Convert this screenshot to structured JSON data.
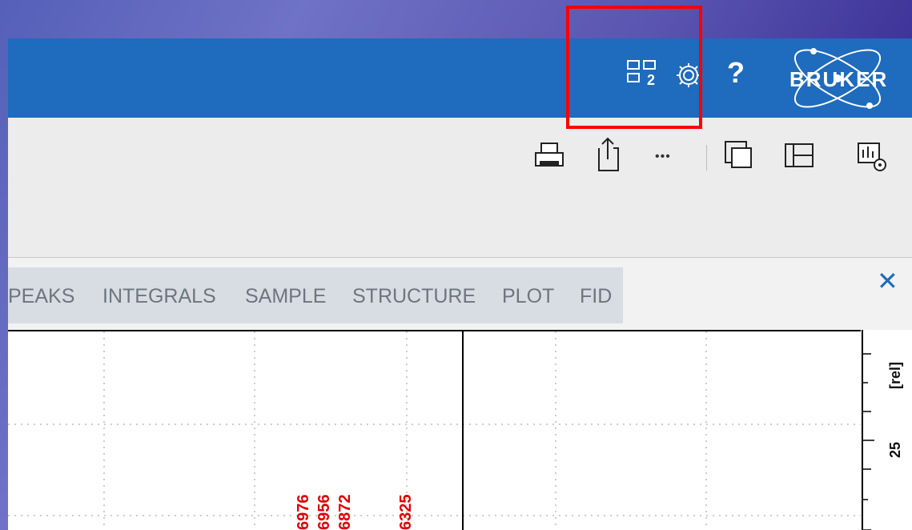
{
  "header": {
    "help_label": "?",
    "logo_text": "BRUKER",
    "layout_badge": "2"
  },
  "tabs": [
    "PEAKS",
    "INTEGRALS",
    "SAMPLE",
    "STRUCTURE",
    "PLOT",
    "FID"
  ],
  "toolbar": {
    "more_label": "•••"
  },
  "close_label": "✕",
  "peaks": [
    "6976",
    "6956",
    "6872",
    "6325"
  ],
  "axis": {
    "unit": "[rel]",
    "tick_label": "25"
  },
  "colors": {
    "titlebar": "#1f6bbd",
    "peak_label": "#e00000",
    "highlight": "#ff0000"
  }
}
